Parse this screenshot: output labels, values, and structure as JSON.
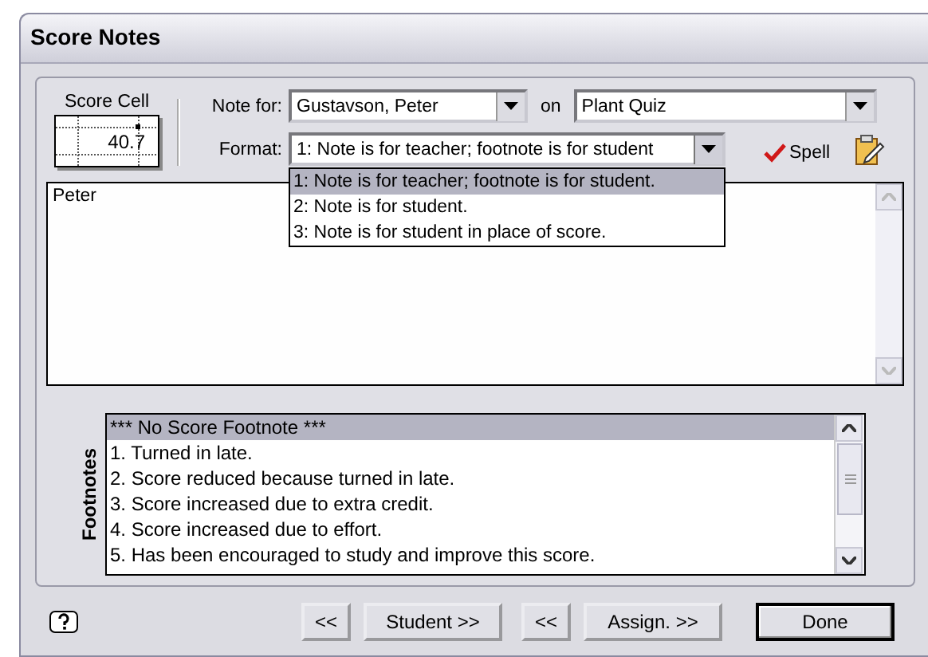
{
  "window": {
    "title": "Score Notes"
  },
  "score_cell": {
    "label": "Score Cell",
    "value": "40.7"
  },
  "note_for": {
    "label": "Note for:",
    "value": "Gustavson, Peter"
  },
  "on": {
    "label": "on",
    "value": "Plant Quiz"
  },
  "format": {
    "label": "Format:",
    "value": "1: Note is for teacher; footnote is for student",
    "expanded": true,
    "options": [
      {
        "label": "1: Note is for teacher; footnote is for student.",
        "selected": true
      },
      {
        "label": "2: Note is for student.",
        "selected": false
      },
      {
        "label": "3: Note is for student in place of score.",
        "selected": false
      }
    ]
  },
  "spell_button": {
    "label": "Spell"
  },
  "note_text": "Peter",
  "footnotes": {
    "label": "Footnotes",
    "items": [
      {
        "text": "*** No Score Footnote ***",
        "selected": true
      },
      {
        "text": "1. Turned in late.",
        "selected": false
      },
      {
        "text": "2. Score reduced because turned in late.",
        "selected": false
      },
      {
        "text": "3. Score increased due to extra credit.",
        "selected": false
      },
      {
        "text": "4. Score increased due to effort.",
        "selected": false
      },
      {
        "text": "5. Has been encouraged to study and improve this score.",
        "selected": false
      }
    ]
  },
  "buttons": [
    {
      "label": "<<",
      "default": false,
      "kind": "previous"
    },
    {
      "label": "Student >>",
      "default": false,
      "kind": "next"
    },
    {
      "label": "<<",
      "default": false,
      "kind": "previous"
    },
    {
      "label": "Assign. >>",
      "default": false,
      "kind": "next"
    },
    {
      "label": "Done",
      "default": true,
      "kind": "action"
    }
  ]
}
